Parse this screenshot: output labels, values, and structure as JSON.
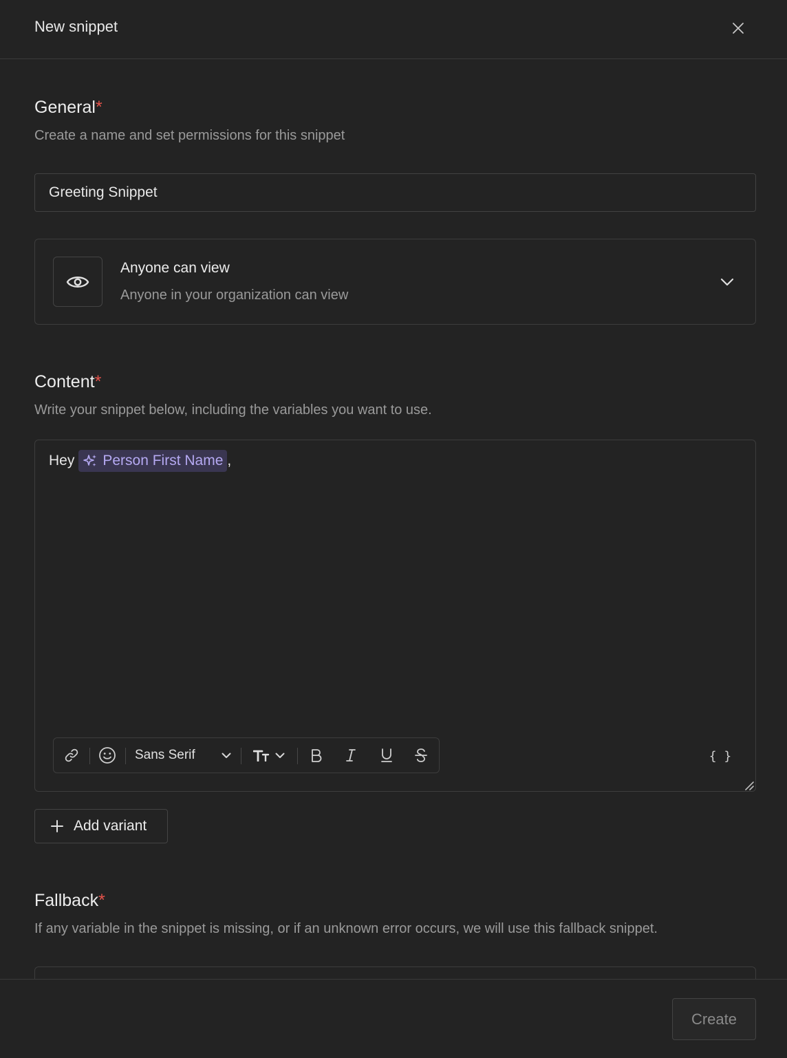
{
  "header": {
    "title": "New snippet",
    "close_icon": "close-icon"
  },
  "general": {
    "title": "General",
    "required_mark": "*",
    "description": "Create a name and set permissions for this snippet",
    "name_value": "Greeting Snippet"
  },
  "permissions": {
    "icon": "eye-icon",
    "title": "Anyone can view",
    "subtitle": "Anyone in your organization can view"
  },
  "content": {
    "title": "Content",
    "required_mark": "*",
    "description": "Write your snippet below, including the variables you want to use.",
    "text_before": "Hey",
    "variable": "Person First Name",
    "text_after": ",",
    "toolbar": {
      "font": "Sans Serif",
      "variables_label": "{ }"
    }
  },
  "add_variant": {
    "label": "Add variant"
  },
  "fallback": {
    "title": "Fallback",
    "required_mark": "*",
    "description": "If any variable in the snippet is missing, or if an unknown error occurs, we will use this fallback snippet."
  },
  "footer": {
    "create_label": "Create"
  },
  "colors": {
    "background": "#232323",
    "required": "#e5534b",
    "variable_chip_bg": "#3a3651",
    "variable_chip_text": "#b5a9f2"
  }
}
